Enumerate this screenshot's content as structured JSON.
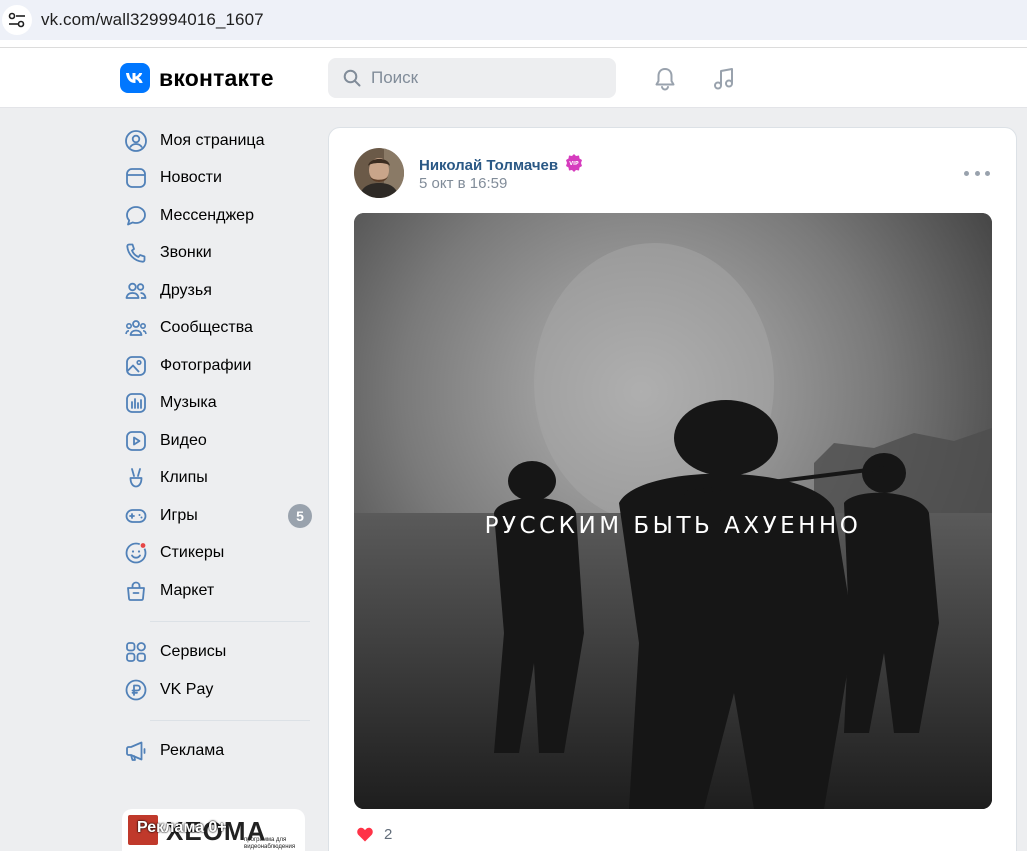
{
  "browser": {
    "url": "vk.com/wall329994016_1607"
  },
  "header": {
    "logo_text": "вконтакте",
    "search_placeholder": "Поиск"
  },
  "sidebar": {
    "items": [
      {
        "label": "Моя страница",
        "icon": "user-circle-icon"
      },
      {
        "label": "Новости",
        "icon": "news-icon"
      },
      {
        "label": "Мессенджер",
        "icon": "message-icon"
      },
      {
        "label": "Звонки",
        "icon": "phone-icon"
      },
      {
        "label": "Друзья",
        "icon": "friends-icon"
      },
      {
        "label": "Сообщества",
        "icon": "communities-icon"
      },
      {
        "label": "Фотографии",
        "icon": "photo-icon"
      },
      {
        "label": "Музыка",
        "icon": "music-icon"
      },
      {
        "label": "Видео",
        "icon": "video-icon"
      },
      {
        "label": "Клипы",
        "icon": "clips-icon"
      },
      {
        "label": "Игры",
        "icon": "gamepad-icon",
        "badge": "5"
      },
      {
        "label": "Стикеры",
        "icon": "sticker-icon"
      },
      {
        "label": "Маркет",
        "icon": "market-icon"
      }
    ],
    "items2": [
      {
        "label": "Сервисы",
        "icon": "services-icon"
      },
      {
        "label": "VK Pay",
        "icon": "vkpay-icon"
      }
    ],
    "items3": [
      {
        "label": "Реклама",
        "icon": "megaphone-icon"
      }
    ],
    "ad": {
      "label": "Реклама 0+",
      "logo": "XEOMA",
      "subtitle": "программа для видеонаблюдения"
    }
  },
  "post": {
    "author": "Николай Толмачев",
    "date": "5 окт в 16:59",
    "image_caption": "РУССКИМ БЫТЬ АХУЕННО",
    "likes": "2"
  },
  "colors": {
    "accent": "#0077ff",
    "link": "#2a5885",
    "muted": "#818c99",
    "like": "#ff3347"
  }
}
